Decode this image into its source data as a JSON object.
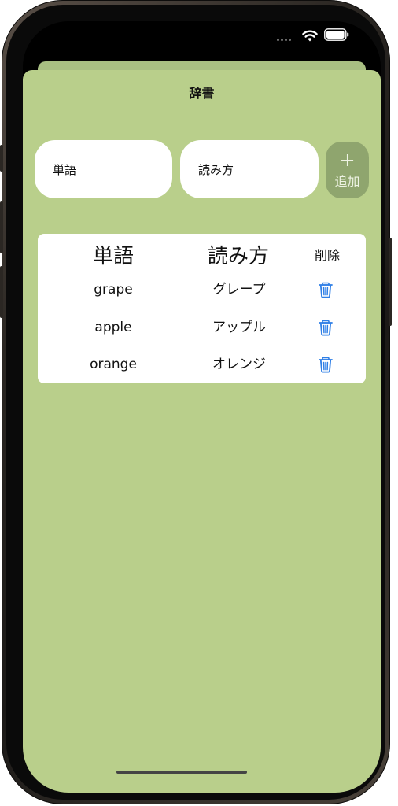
{
  "nav": {
    "title": "辞書"
  },
  "form": {
    "word_placeholder": "単語",
    "reading_placeholder": "読み方",
    "add_icon": "+",
    "add_label": "追加"
  },
  "table": {
    "headers": {
      "word": "単語",
      "reading": "読み方",
      "delete": "削除"
    },
    "rows": [
      {
        "word": "grape",
        "reading": "グレープ"
      },
      {
        "word": "apple",
        "reading": "アップル"
      },
      {
        "word": "orange",
        "reading": "オレンジ"
      }
    ]
  },
  "colors": {
    "background": "#b9cf8b",
    "add_button": "#8fa56e",
    "trash": "#2f7fe6"
  },
  "icons": {
    "status": [
      "signal-icon",
      "wifi-icon",
      "battery-icon"
    ],
    "row_action": "trash-icon"
  }
}
